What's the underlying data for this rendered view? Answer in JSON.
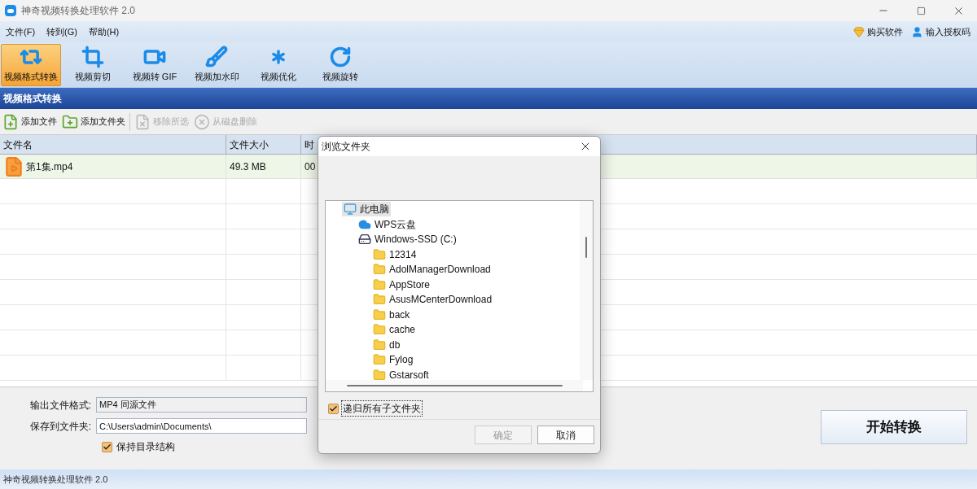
{
  "window": {
    "title": "神奇视频转换处理软件 2.0"
  },
  "menu": [
    "文件(F)",
    "转到(G)",
    "帮助(H)"
  ],
  "header_links": [
    {
      "kind": "buy",
      "label": "购买软件"
    },
    {
      "kind": "license",
      "label": "输入授权码"
    }
  ],
  "tools": [
    {
      "kind": "convert",
      "label": "视频格式转换",
      "selected": true
    },
    {
      "kind": "crop",
      "label": "视频剪切",
      "selected": false
    },
    {
      "kind": "gif",
      "label": "视频转 GIF",
      "selected": false
    },
    {
      "kind": "watermark",
      "label": "视频加水印",
      "selected": false
    },
    {
      "kind": "optimize",
      "label": "视频优化",
      "selected": false
    },
    {
      "kind": "rotate",
      "label": "视频旋转",
      "selected": false
    }
  ],
  "section_title": "视频格式转换",
  "actions": [
    {
      "kind": "add_file",
      "label": "添加文件",
      "disabled": false
    },
    {
      "kind": "add_folder",
      "label": "添加文件夹",
      "disabled": false
    },
    {
      "kind": "remove",
      "label": "移除所选",
      "disabled": true
    },
    {
      "kind": "delete",
      "label": "从磁盘删除",
      "disabled": true
    }
  ],
  "table": {
    "columns": [
      "文件名",
      "文件大小",
      "时"
    ],
    "rows": [
      {
        "cells": [
          "第1集.mp4",
          "49.3 MB",
          "00"
        ],
        "selected": true
      }
    ]
  },
  "output_format": {
    "label": "输出文件格式:",
    "value": "MP4 同源文件"
  },
  "save_folder": {
    "label": "保存到文件夹:",
    "value": "C:\\Users\\admin\\Documents\\"
  },
  "keep_structure": {
    "label": "保持目录结构",
    "checked": true
  },
  "start_button": "开始转换",
  "status_bar": "神奇视频转换处理软件 2.0",
  "dialog": {
    "title": "浏览文件夹",
    "tree": [
      {
        "kind": "pc",
        "label": "此电脑",
        "selected": true,
        "children": [
          {
            "kind": "cloud",
            "label": "WPS云盘",
            "selected": false
          },
          {
            "kind": "drive",
            "label": "Windows-SSD (C:)",
            "selected": false,
            "children": [
              {
                "kind": "folder",
                "label": "12314",
                "selected": false
              },
              {
                "kind": "folder",
                "label": "AdolManagerDownload",
                "selected": false
              },
              {
                "kind": "folder",
                "label": "AppStore",
                "selected": false
              },
              {
                "kind": "folder",
                "label": "AsusMCenterDownload",
                "selected": false
              },
              {
                "kind": "folder",
                "label": "back",
                "selected": false
              },
              {
                "kind": "folder",
                "label": "cache",
                "selected": false
              },
              {
                "kind": "folder",
                "label": "db",
                "selected": false
              },
              {
                "kind": "folder",
                "label": "Fylog",
                "selected": false
              },
              {
                "kind": "folder",
                "label": "Gstarsoft",
                "selected": false
              }
            ]
          }
        ]
      }
    ],
    "recursive": {
      "label": "递归所有子文件夹",
      "checked": true
    },
    "buttons": [
      {
        "label": "确定",
        "disabled": true
      },
      {
        "label": "取消",
        "disabled": false
      }
    ]
  }
}
